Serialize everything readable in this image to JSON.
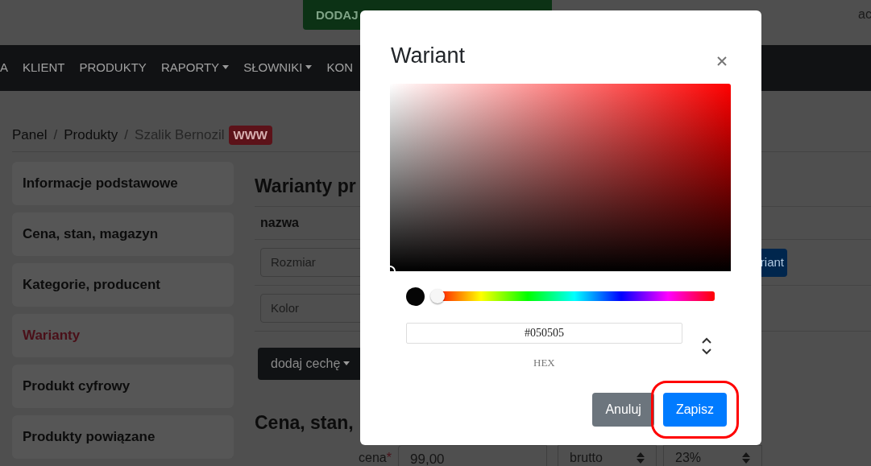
{
  "header": {
    "promo_button": "DODAJ",
    "user": "ac"
  },
  "navbar": {
    "items": [
      {
        "label": "A",
        "dropdown": false
      },
      {
        "label": "KLIENT",
        "dropdown": false
      },
      {
        "label": "PRODUKTY",
        "dropdown": false
      },
      {
        "label": "RAPORTY",
        "dropdown": true
      },
      {
        "label": "SŁOWNIKI",
        "dropdown": true
      },
      {
        "label": "KON",
        "dropdown": false
      }
    ]
  },
  "breadcrumb": {
    "items": [
      "Panel",
      "Produkty",
      "Szalik Bernozil"
    ],
    "separator": "/",
    "badge": "WWW"
  },
  "sidebar": {
    "items": [
      {
        "label": "Informacje podstawowe",
        "selected": false
      },
      {
        "label": "Cena, stan, magazyn",
        "selected": false
      },
      {
        "label": "Kategorie, producent",
        "selected": false
      },
      {
        "label": "Warianty",
        "selected": true
      },
      {
        "label": "Produkt cyfrowy",
        "selected": false
      },
      {
        "label": "Produkty powiązane",
        "selected": false
      }
    ]
  },
  "content": {
    "heading": "Warianty pr",
    "column_header": "nazwa",
    "features": [
      "Rozmiar",
      "Kolor"
    ],
    "add_variant_button": "riant",
    "add_feature_button": "dodaj cechę",
    "section_heading": "Cena, stan,",
    "price": {
      "label": "cena",
      "required_mark": "*",
      "value": "99,00",
      "type": "brutto",
      "vat": "23%"
    }
  },
  "modal": {
    "title": "Wariant",
    "color_picker": {
      "hex": "#050505",
      "mode": "HEX",
      "hue": {
        "level": 0
      }
    },
    "buttons": [
      {
        "label": "Anuluj",
        "kind": "secondary",
        "highlighted": false
      },
      {
        "label": "Zapisz",
        "kind": "primary",
        "highlighted": true
      }
    ]
  }
}
